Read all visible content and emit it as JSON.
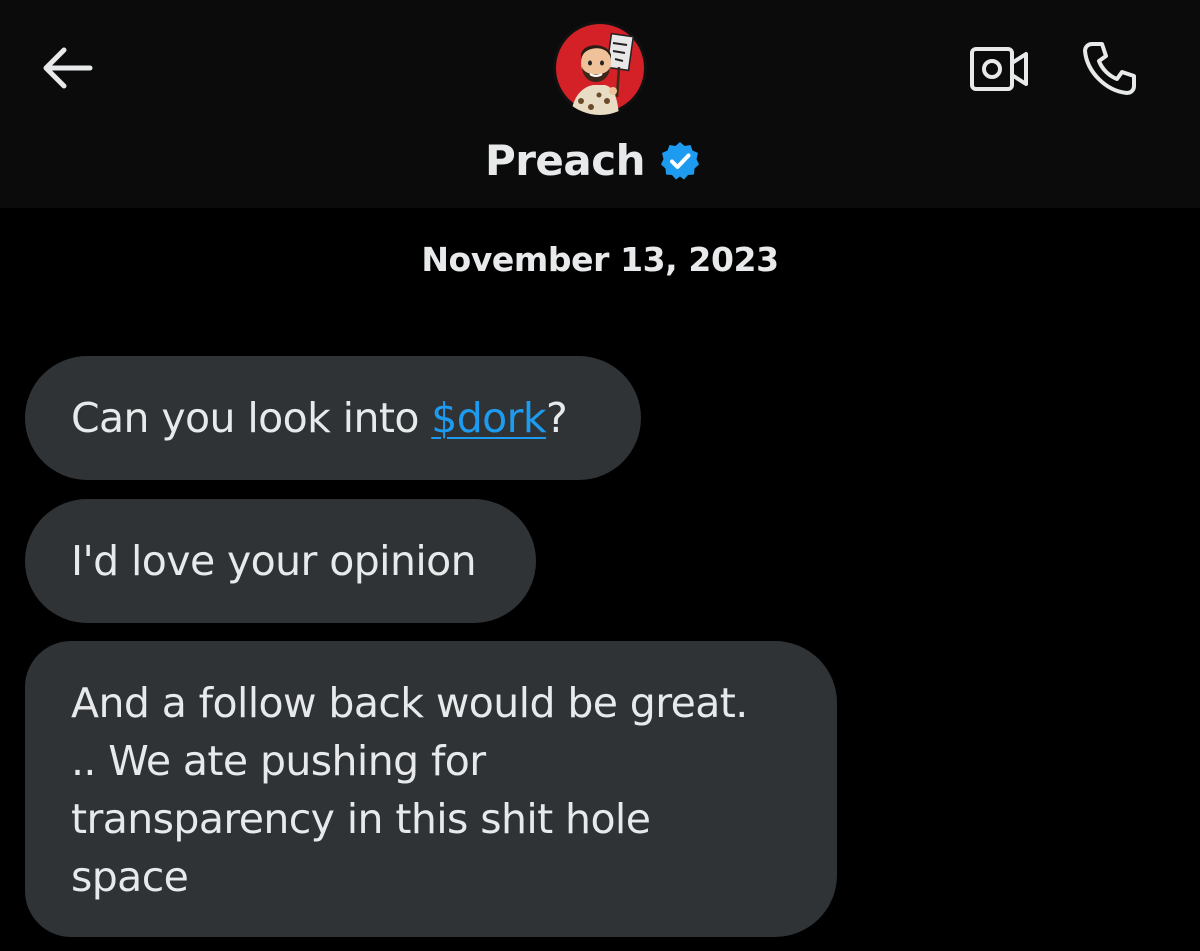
{
  "header": {
    "contact_name": "Preach",
    "verified": true,
    "back_icon": "arrow-left-icon",
    "video_icon": "video-camera-icon",
    "call_icon": "phone-icon"
  },
  "conversation": {
    "date": "November 13, 2023",
    "messages": [
      {
        "before": "Can you look into ",
        "cashtag": "$dork",
        "after": "?"
      },
      {
        "text": "I'd love your opinion"
      },
      {
        "lines": [
          "And a follow back would be great.",
          ".. We ate pushing for",
          "transparency in this shit hole",
          "space"
        ]
      }
    ]
  },
  "colors": {
    "background": "#000000",
    "header_background": "#0b0b0b",
    "bubble": "#2f3336",
    "text": "#e7e9ea",
    "accent": "#1d9bf0"
  }
}
